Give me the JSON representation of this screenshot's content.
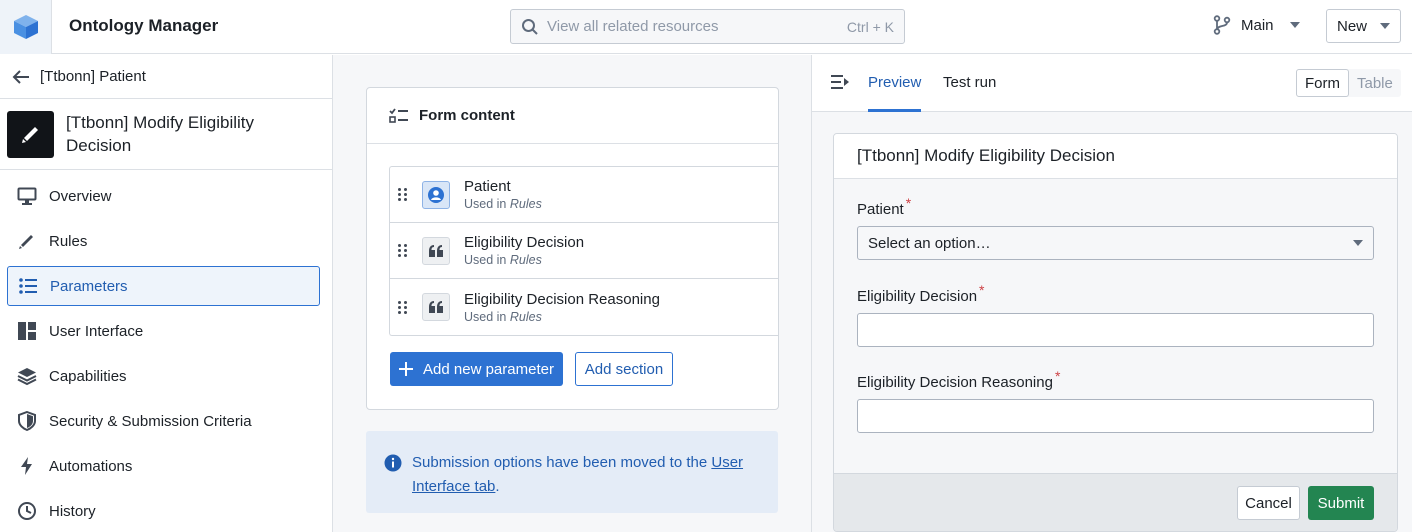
{
  "header": {
    "app_title": "Ontology Manager",
    "search_placeholder": "View all related resources",
    "search_shortcut": "Ctrl + K",
    "branch": "Main",
    "new_label": "New"
  },
  "sidebar": {
    "back_label": "[Ttbonn] Patient",
    "action_title": "[Ttbonn] Modify Eligibility Decision",
    "items": [
      {
        "label": "Overview",
        "icon": "desktop-icon"
      },
      {
        "label": "Rules",
        "icon": "edit-icon"
      },
      {
        "label": "Parameters",
        "icon": "properties-icon",
        "active": true
      },
      {
        "label": "User Interface",
        "icon": "layout-icon"
      },
      {
        "label": "Capabilities",
        "icon": "layers-icon"
      },
      {
        "label": "Security & Submission Criteria",
        "icon": "shield-icon"
      },
      {
        "label": "Automations",
        "icon": "lightning-icon"
      },
      {
        "label": "History",
        "icon": "history-icon"
      }
    ]
  },
  "form_content": {
    "title": "Form content",
    "params": [
      {
        "name": "Patient",
        "used_prefix": "Used in",
        "used_in": "Rules",
        "icon": "object-icon"
      },
      {
        "name": "Eligibility Decision",
        "used_prefix": "Used in",
        "used_in": "Rules",
        "icon": "quote-icon"
      },
      {
        "name": "Eligibility Decision Reasoning",
        "used_prefix": "Used in",
        "used_in": "Rules",
        "icon": "quote-icon"
      }
    ],
    "add_parameter": "Add new parameter",
    "add_section": "Add section"
  },
  "callout": {
    "text_before": "Submission options have been moved to the ",
    "link": "User Interface tab",
    "text_after": "."
  },
  "preview": {
    "tabs": [
      "Preview",
      "Test run"
    ],
    "active_tab": "Preview",
    "view_toggle": [
      "Form",
      "Table"
    ],
    "active_view": "Form",
    "form_title": "[Ttbonn] Modify Eligibility Decision",
    "fields": [
      {
        "label": "Patient",
        "required": "*",
        "type": "select",
        "value": "Select an option…"
      },
      {
        "label": "Eligibility Decision",
        "required": "*",
        "type": "text",
        "value": ""
      },
      {
        "label": "Eligibility Decision Reasoning",
        "required": "*",
        "type": "text",
        "value": ""
      }
    ],
    "cancel_label": "Cancel",
    "submit_label": "Submit"
  },
  "colors": {
    "primary": "#2d72d2",
    "success": "#238551",
    "required": "#cd4246"
  }
}
